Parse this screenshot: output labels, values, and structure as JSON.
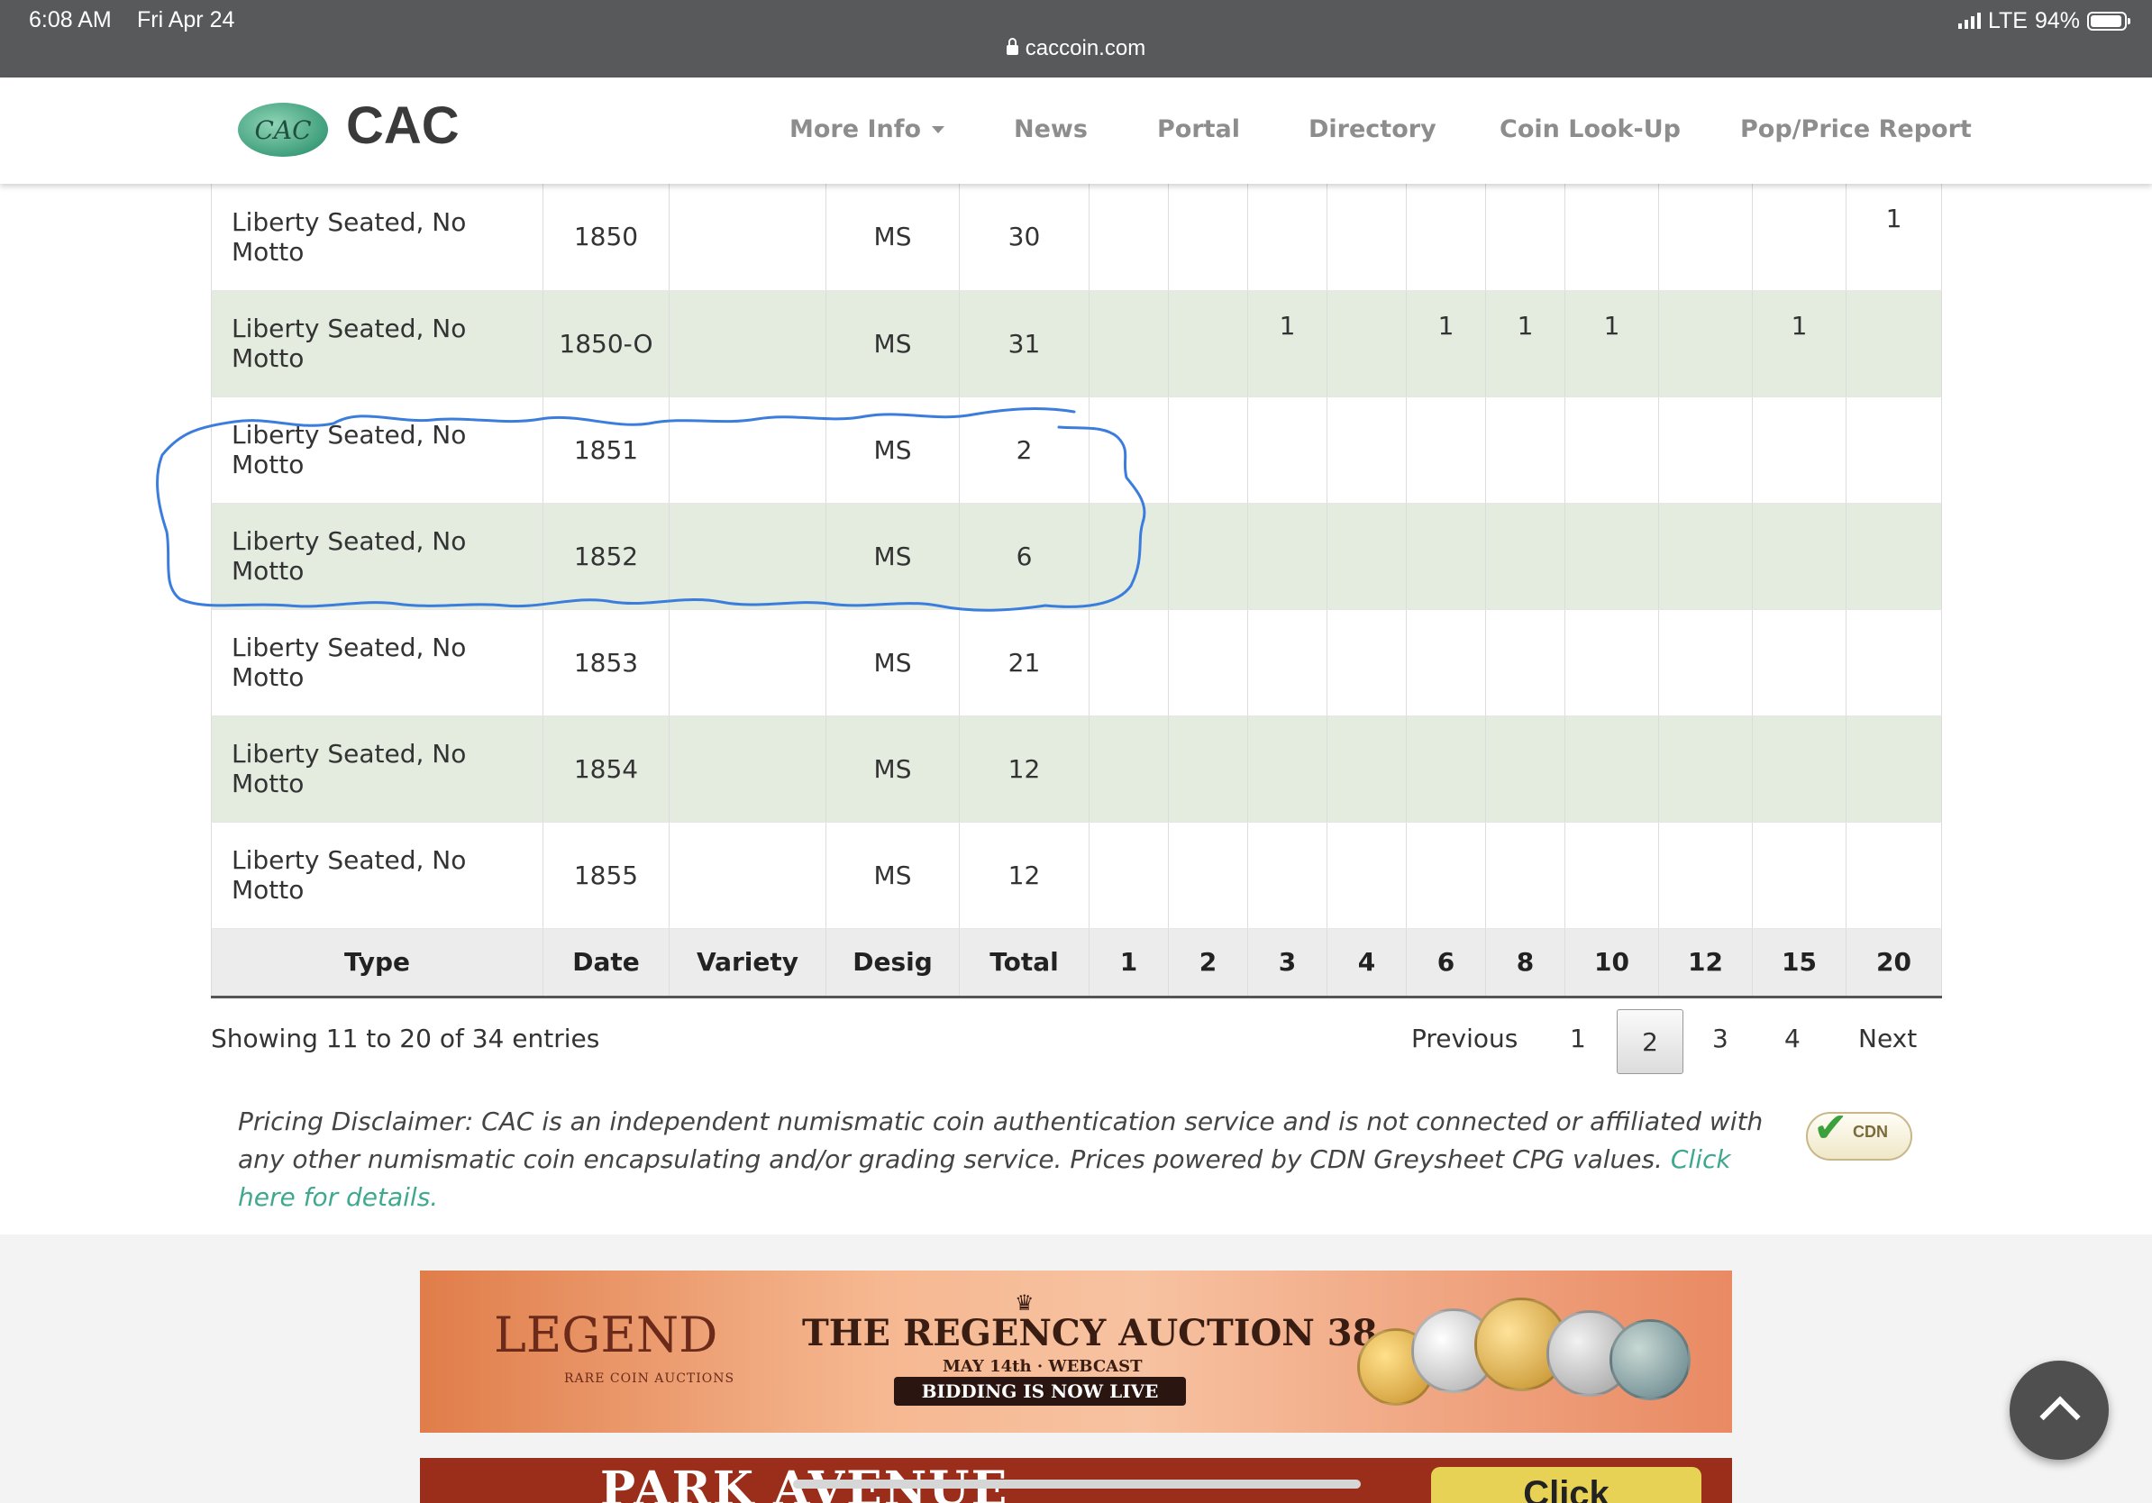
{
  "status_bar": {
    "time": "6:08 AM",
    "date": "Fri Apr 24",
    "url": "caccoin.com",
    "network": "LTE",
    "battery": "94%",
    "battery_level": 0.94
  },
  "header": {
    "logo_mark": "CAC",
    "logo_text": "CAC",
    "nav": [
      "More Info",
      "News",
      "Portal",
      "Directory",
      "Coin Look-Up",
      "Pop/Price Report"
    ]
  },
  "table": {
    "columns": [
      "Type",
      "Date",
      "Variety",
      "Desig",
      "Total",
      "1",
      "2",
      "3",
      "4",
      "6",
      "8",
      "10",
      "12",
      "15",
      "20"
    ],
    "rows": [
      [
        "Liberty Seated, No Motto",
        "1850",
        "",
        "MS",
        "30",
        "",
        "",
        "",
        "",
        "",
        "",
        "",
        "",
        "",
        "1"
      ],
      [
        "Liberty Seated, No Motto",
        "1850-O",
        "",
        "MS",
        "31",
        "",
        "",
        "1",
        "",
        "1",
        "1",
        "1",
        "",
        "1",
        ""
      ],
      [
        "Liberty Seated, No Motto",
        "1851",
        "",
        "MS",
        "2",
        "",
        "",
        "",
        "",
        "",
        "",
        "",
        "",
        "",
        ""
      ],
      [
        "Liberty Seated, No Motto",
        "1852",
        "",
        "MS",
        "6",
        "",
        "",
        "",
        "",
        "",
        "",
        "",
        "",
        "",
        ""
      ],
      [
        "Liberty Seated, No Motto",
        "1853",
        "",
        "MS",
        "21",
        "",
        "",
        "",
        "",
        "",
        "",
        "",
        "",
        "",
        ""
      ],
      [
        "Liberty Seated, No Motto",
        "1854",
        "",
        "MS",
        "12",
        "",
        "",
        "",
        "",
        "",
        "",
        "",
        "",
        "",
        ""
      ],
      [
        "Liberty Seated, No Motto",
        "1855",
        "",
        "MS",
        "12",
        "",
        "",
        "",
        "",
        "",
        "",
        "",
        "",
        "",
        ""
      ]
    ]
  },
  "pagination": {
    "info": "Showing 11 to 20 of 34 entries",
    "previous": "Previous",
    "pages": [
      "1",
      "2",
      "3",
      "4"
    ],
    "current": "2",
    "next": "Next"
  },
  "disclaimer": {
    "text": "Pricing Disclaimer: CAC is an independent numismatic coin authentication service and is not connected or affiliated with any other numismatic coin encapsulating and/or grading service. Prices powered by CDN Greysheet CPG values.",
    "link": "Click here for details.",
    "badge": "CDN"
  },
  "ads": {
    "ad1": {
      "brand": "LEGEND",
      "brand_sub": "RARE COIN AUCTIONS",
      "headline": "THE REGENCY AUCTION 38",
      "subline": "MAY 14th · WEBCAST",
      "cta": "BIDDING IS NOW LIVE"
    },
    "ad2": {
      "brand": "PARK AVENUE",
      "cta": "Click"
    }
  },
  "colors": {
    "status_bar": "#58595b",
    "row_alt": "#e3ecdf",
    "link": "#3fa88e",
    "annotation": "#3b7ddd"
  }
}
